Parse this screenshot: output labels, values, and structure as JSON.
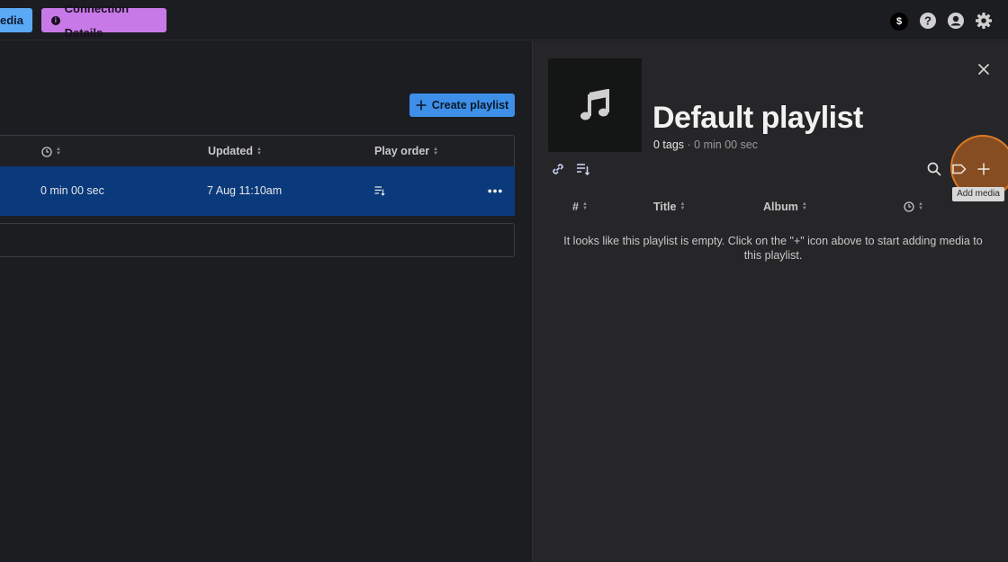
{
  "topbar": {
    "media_label": "Media",
    "connection_label": "Connection Details",
    "icons": [
      "dollar-icon",
      "help-icon",
      "account-icon",
      "settings-icon"
    ],
    "dollar_symbol": "$"
  },
  "playlists": {
    "create_label": "Create playlist",
    "columns": {
      "duration_icon": "clock-icon",
      "updated": "Updated",
      "play_order": "Play order"
    },
    "rows": [
      {
        "duration": "0 min 00 sec",
        "updated": "7 Aug 11:10am",
        "play_order_icon": "sort-order-icon",
        "more_icon": "ellipsis-icon"
      }
    ]
  },
  "detail": {
    "title": "Default playlist",
    "tags": "0 tags",
    "duration": " · 0 min 00 sec",
    "tooltip": "Add media",
    "columns": {
      "number": "#",
      "title": "Title",
      "album": "Album",
      "duration_icon": "clock-icon"
    },
    "empty_message": "It looks like this playlist is empty. Click on the \"+\" icon above to start adding media to this playlist."
  },
  "colors": {
    "media_button": "#5aa9f7",
    "connection_button": "#c879e8",
    "create_button": "#3d8fe8",
    "selected_row": "#0b3a7c",
    "highlight": "#e87e28"
  }
}
